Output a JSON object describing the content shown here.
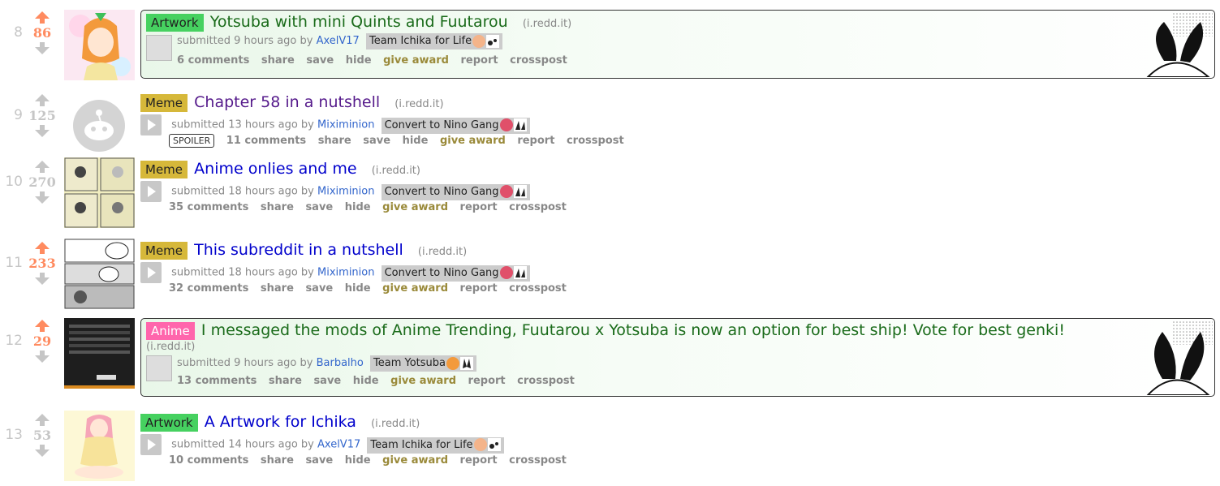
{
  "posts": [
    {
      "rank": "8",
      "score": "86",
      "flair": "Artwork",
      "title": "Yotsuba with mini Quints and Fuutarou",
      "domain": "(i.redd.it)",
      "submitted": "submitted 9 hours ago by",
      "author": "AxelV17",
      "user_flair": "Team Ichika for Life",
      "comments": "6 comments"
    },
    {
      "rank": "9",
      "score": "125",
      "flair": "Meme",
      "title": "Chapter 58 in a nutshell",
      "domain": "(i.redd.it)",
      "submitted": "submitted 13 hours ago by",
      "author": "Miximinion",
      "user_flair": "Convert to Nino Gang",
      "comments": "11 comments",
      "spoiler": "SPOILER"
    },
    {
      "rank": "10",
      "score": "270",
      "flair": "Meme",
      "title": "Anime onlies and me",
      "domain": "(i.redd.it)",
      "submitted": "submitted 18 hours ago by",
      "author": "Miximinion",
      "user_flair": "Convert to Nino Gang",
      "comments": "35 comments"
    },
    {
      "rank": "11",
      "score": "233",
      "flair": "Meme",
      "title": "This subreddit in a nutshell",
      "domain": "(i.redd.it)",
      "submitted": "submitted 18 hours ago by",
      "author": "Miximinion",
      "user_flair": "Convert to Nino Gang",
      "comments": "32 comments"
    },
    {
      "rank": "12",
      "score": "29",
      "flair": "Anime",
      "title": "I messaged the mods of Anime Trending, Fuutarou x Yotsuba is now an option for best ship! Vote for best genki!",
      "domain": "(i.redd.it)",
      "submitted": "submitted 9 hours ago by",
      "author": "Barbalho",
      "user_flair": "Team Yotsuba",
      "comments": "13 comments"
    },
    {
      "rank": "13",
      "score": "53",
      "flair": "Artwork",
      "title": "A Artwork for Ichika",
      "domain": "(i.redd.it)",
      "submitted": "submitted 14 hours ago by",
      "author": "AxelV17",
      "user_flair": "Team Ichika for Life",
      "comments": "10 comments"
    }
  ],
  "actions": {
    "share": "share",
    "save": "save",
    "hide": "hide",
    "give_award": "give award",
    "report": "report",
    "crosspost": "crosspost"
  },
  "colors": {
    "upvoted": "#ff8b60",
    "neutral": "#c6c6c6",
    "link": "#0000cc",
    "visited": "#551a8b",
    "highlight_title": "#1a6b1a",
    "artwork_flair": "#46d160",
    "meme_flair": "#d6b83a",
    "anime_flair": "#ff66ac"
  }
}
